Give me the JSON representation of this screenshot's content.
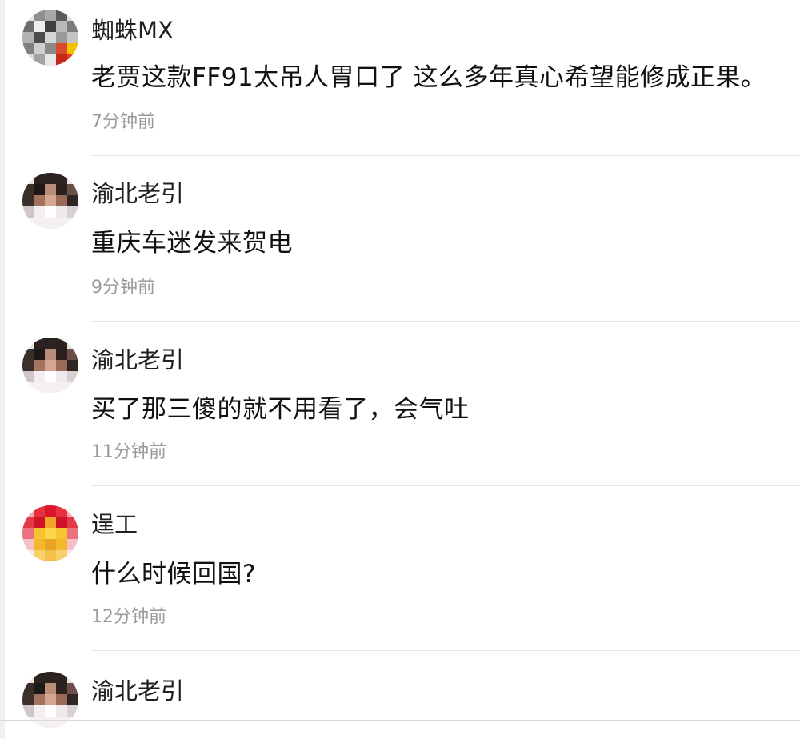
{
  "comments": [
    {
      "username": "蜘蛛MX",
      "avatar": "pixelated-gray-avatar-icon",
      "content": "老贾这款FF91太吊人胃口了 这么多年真心希望能修成正果。",
      "time": "7分钟前"
    },
    {
      "username": "渝北老引",
      "avatar": "pixelated-person-avatar-icon",
      "content": "重庆车迷发来贺电",
      "time": "9分钟前"
    },
    {
      "username": "渝北老引",
      "avatar": "pixelated-person-avatar-icon",
      "content": "买了那三傻的就不用看了，会气吐",
      "time": "11分钟前"
    },
    {
      "username": "逞工",
      "avatar": "pixelated-red-yellow-avatar-icon",
      "content": "什么时候回国?",
      "time": "12分钟前"
    },
    {
      "username": "渝北老引",
      "avatar": "pixelated-person-avatar-icon",
      "content": "",
      "time": ""
    }
  ],
  "colors": {
    "text_primary": "#111111",
    "text_secondary": "#9a9a9a",
    "divider": "#e6e6e6"
  }
}
